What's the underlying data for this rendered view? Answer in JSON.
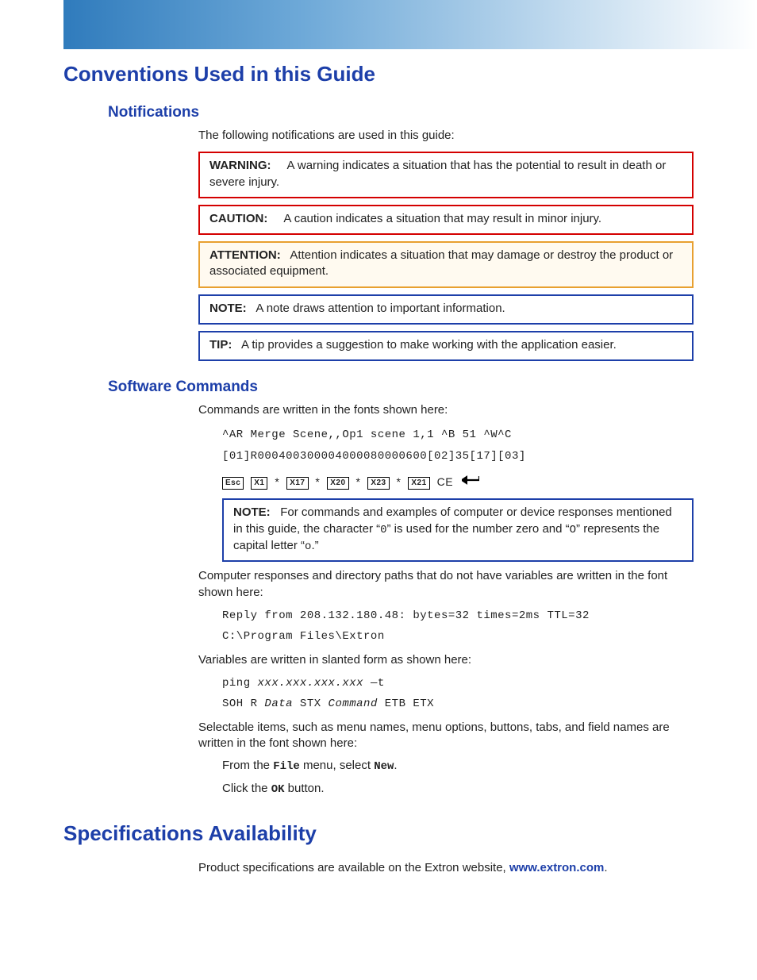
{
  "h1a": "Conventions Used in this Guide",
  "notifications": {
    "heading": "Notifications",
    "intro": "The following notifications are used in this guide:",
    "warning_label": "WARNING:",
    "warning_text": "A warning indicates a situation that has the potential to result in death or severe injury.",
    "caution_label": "CAUTION:",
    "caution_text": "A caution indicates a situation that may result in minor injury.",
    "attention_label": "ATTENTION:",
    "attention_text": "Attention indicates a situation that may damage or destroy the product or associated equipment.",
    "note_label": "NOTE:",
    "note_text": "A note draws attention to important information.",
    "tip_label": "TIP:",
    "tip_text": "A tip provides a suggestion to make working with the application easier."
  },
  "software": {
    "heading": "Software Commands",
    "intro": "Commands are written in the fonts shown here:",
    "cmd1": "^AR Merge Scene,,Op1 scene 1,1 ^B 51 ^W^C",
    "cmd2": "[01]R000400300004000080000600[02]35[17][03]",
    "esc": "Esc",
    "x1": "X1",
    "x17": "X17",
    "x20": "X20",
    "x23": "X23",
    "x21": "X21",
    "star": "*",
    "ce": "CE",
    "note_label": "NOTE:",
    "note_p1a": "For commands and examples of computer or device responses mentioned in this guide, the character “",
    "note_zero": "0",
    "note_p1b": "” is used for the number zero and “",
    "note_o": "O",
    "note_p1c": "” represents the capital letter “",
    "note_o2": "o",
    "note_p1d": ".”",
    "resp_intro": "Computer responses and directory paths that do not have variables are written in the font shown here:",
    "resp1": "Reply from 208.132.180.48: bytes=32 times=2ms TTL=32",
    "resp2": "C:\\Program Files\\Extron",
    "var_intro": "Variables are written in slanted form as shown here:",
    "var1a": "ping ",
    "var1b": "xxx.xxx.xxx.xxx",
    "var1c": " —t",
    "var2a": "SOH R ",
    "var2b": "Data",
    "var2c": " STX ",
    "var2d": "Command",
    "var2e": " ETB ETX",
    "sel_intro": "Selectable items, such as menu names, menu options, buttons, tabs, and field names are written in the font shown here:",
    "sel1a": "From the ",
    "sel1b": "File",
    "sel1c": " menu, select ",
    "sel1d": "New",
    "sel1e": ".",
    "sel2a": "Click the ",
    "sel2b": "OK",
    "sel2c": " button."
  },
  "specs": {
    "heading": "Specifications Availability",
    "text": "Product specifications are available on the Extron website, ",
    "link": "www.extron.com",
    "dot": "."
  }
}
